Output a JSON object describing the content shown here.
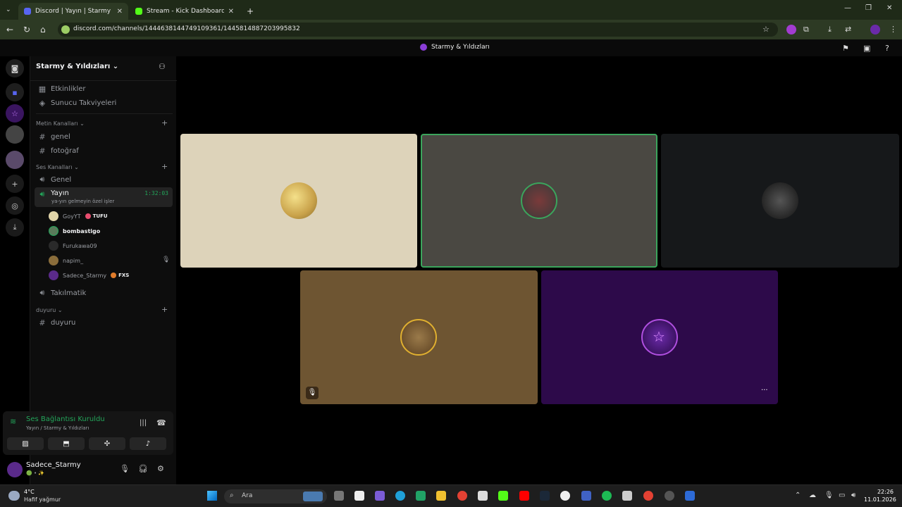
{
  "browser": {
    "tabs": [
      {
        "title": "Discord | Yayın | Starmy & Yı",
        "active": true
      },
      {
        "title": "Stream - Kick Dashboard",
        "active": false
      }
    ],
    "url": "discord.com/channels/1444638144749109361/1445814887203995832"
  },
  "discord": {
    "window_title": "Starmy & Yıldızları",
    "server_name": "Starmy & Yıldızları",
    "top_items": [
      "Etkinlikler",
      "Sunucu Takviyeleri"
    ],
    "categories": {
      "text": "Metin Kanalları",
      "voice": "Ses Kanalları",
      "announce": "duyuru"
    },
    "text_channels": [
      "genel",
      "fotoğraf"
    ],
    "voice_channels": {
      "genel": "Genel",
      "active": {
        "name": "Yayın",
        "time": "1:32:03",
        "status": "ya-yın gelmeyin özel işler"
      },
      "other": "Takılmatik"
    },
    "voice_users": [
      {
        "name": "GoyYT",
        "tag": "TUFU",
        "tag_color": "#e84d6f",
        "avatar": "#e0d4a8"
      },
      {
        "name": "bombastigo",
        "tag": "",
        "tag_color": "",
        "avatar": "#5a7a5a"
      },
      {
        "name": "Furukawa09",
        "tag": "",
        "tag_color": "",
        "avatar": "#2a2a2a"
      },
      {
        "name": "napim_",
        "tag": "",
        "tag_color": "",
        "avatar": "#8a6d3b"
      },
      {
        "name": "Sadece_Starmy",
        "tag": "FXS",
        "tag_color": "#e07b2a",
        "avatar": "#5a2a8a"
      }
    ],
    "announce_channel": "duyuru",
    "voice_panel": {
      "title": "Ses Bağlantısı Kuruldu",
      "subtitle": "Yayın / Starmy & Yıldızları"
    },
    "user_panel": {
      "username": "Sadece_Starmy",
      "status": "🟢 • ✨"
    }
  },
  "tiles": [
    {
      "user": "GoyYT",
      "bg": "#ddd3ba",
      "avatar": "#c9a24a",
      "speaking": false
    },
    {
      "user": "bombastigo",
      "bg": "#4a4842",
      "avatar": "#8c3b3b",
      "speaking": true
    },
    {
      "user": "Furukawa09",
      "bg": "#16181a",
      "avatar": "#3a3a3a",
      "speaking": false
    },
    {
      "user": "napim_",
      "bg": "#6e5532",
      "avatar": "#9a7a4a",
      "speaking": false
    },
    {
      "user": "Sadece_Starmy",
      "bg": "#2d0a4a",
      "avatar": "#4a1670",
      "speaking": false
    }
  ],
  "taskbar": {
    "weather_temp": "4°C",
    "weather_desc": "Hafif yağmur",
    "search": "Ara",
    "time": "22:26",
    "date": "11.01.2026"
  },
  "colors": {
    "accent_green": "#23a55a",
    "speaking_border": "#3ba55c",
    "chrome_bg": "#2d3a24"
  }
}
